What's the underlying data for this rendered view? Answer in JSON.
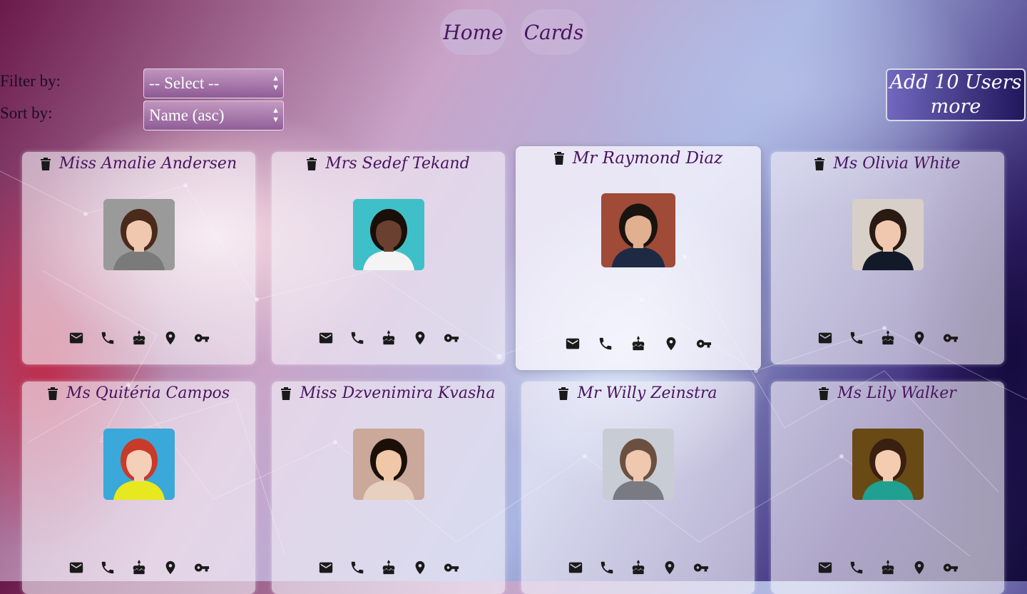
{
  "nav": {
    "home": "Home",
    "cards": "Cards"
  },
  "controls": {
    "filter_label": "Filter by:",
    "filter_value": "-- Select --",
    "sort_label": "Sort by:",
    "sort_value": "Name (asc)",
    "add_button": "Add 10 Users more"
  },
  "colors": {
    "name_text": "#4a1460",
    "nav_bg": "#c8b4d7"
  },
  "users": [
    {
      "name": "Miss Amalie Andersen",
      "avatar": {
        "bg": "#9a9a9a",
        "skin": "#f0c8b0",
        "hair": "#4a2a1a",
        "shirt": "#7a7a7a"
      }
    },
    {
      "name": "Mrs Sedef Tekand",
      "avatar": {
        "bg": "#3fc0c8",
        "skin": "#6a4030",
        "hair": "#1a0e08",
        "shirt": "#f4f4f4"
      }
    },
    {
      "name": "Mr Raymond Diaz",
      "avatar": {
        "bg": "#a04a38",
        "skin": "#e0b090",
        "hair": "#1a1410",
        "shirt": "#1e2a44"
      }
    },
    {
      "name": "Ms Olivia White",
      "avatar": {
        "bg": "#d8d0c8",
        "skin": "#f0c8b0",
        "hair": "#2a1a12",
        "shirt": "#121a2a"
      }
    },
    {
      "name": "Ms Quitéria Campos",
      "avatar": {
        "bg": "#3aa8d8",
        "skin": "#f4d0b8",
        "hair": "#c83a2a",
        "shirt": "#e8e820"
      }
    },
    {
      "name": "Miss Dzvenimira Kvasha",
      "avatar": {
        "bg": "#caa89a",
        "skin": "#f0c8a8",
        "hair": "#1a1008",
        "shirt": "#e8d0c0"
      }
    },
    {
      "name": "Mr Willy Zeinstra",
      "avatar": {
        "bg": "#c8ccd4",
        "skin": "#f0c8b0",
        "hair": "#6a5040",
        "shirt": "#7a7a82"
      }
    },
    {
      "name": "Ms Lily Walker",
      "avatar": {
        "bg": "#6a4a14",
        "skin": "#f4ccb0",
        "hair": "#3a2010",
        "shirt": "#20a090"
      }
    }
  ],
  "card_icons": [
    "email-icon",
    "phone-icon",
    "cake-icon",
    "location-icon",
    "key-icon"
  ]
}
